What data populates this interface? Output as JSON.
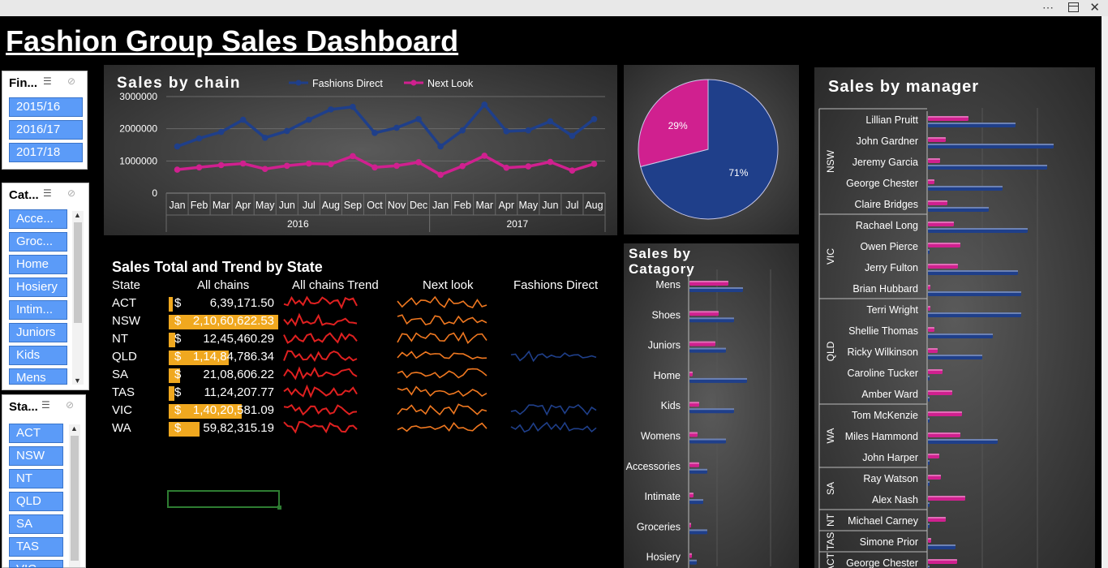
{
  "window": {
    "more_icon": "ellipsis-icon",
    "restore_icon": "restore-icon",
    "close_icon": "close-icon"
  },
  "title": "Fashion Group Sales Dashboard",
  "slicers": {
    "financial_year": {
      "title": "Fin...",
      "items": [
        "2015/16",
        "2016/17",
        "2017/18"
      ]
    },
    "category": {
      "title": "Cat...",
      "items": [
        "Acce...",
        "Groc...",
        "Home",
        "Hosiery",
        "Intim...",
        "Juniors",
        "Kids",
        "Mens"
      ]
    },
    "state": {
      "title": "Sta...",
      "items": [
        "ACT",
        "NSW",
        "NT",
        "QLD",
        "SA",
        "TAS",
        "VIC"
      ]
    }
  },
  "colors": {
    "fashions_direct": "#1f3f8a",
    "next_look": "#d0208f",
    "bar_gold": "#f0a81f",
    "spark_red": "#e02020",
    "spark_orange": "#f07820",
    "spark_blue": "#1f3f8a"
  },
  "table": {
    "title": "Sales Total and Trend by State",
    "headers": {
      "state": "State",
      "all_chains": "All chains",
      "trend": "All chains Trend",
      "next_look": "Next look",
      "fashions_direct": "Fashions Direct"
    },
    "rows": [
      {
        "state": "ACT",
        "dollar": "$",
        "value": "6,39,171.50",
        "share": 0.03
      },
      {
        "state": "NSW",
        "dollar": "$",
        "value": "2,10,60,622.53",
        "share": 1.0
      },
      {
        "state": "NT",
        "dollar": "$",
        "value": "12,45,460.29",
        "share": 0.06
      },
      {
        "state": "QLD",
        "dollar": "$",
        "value": "1,14,84,786.34",
        "share": 0.55
      },
      {
        "state": "SA",
        "dollar": "$",
        "value": "21,08,606.22",
        "share": 0.1
      },
      {
        "state": "TAS",
        "dollar": "$",
        "value": "11,24,207.77",
        "share": 0.05
      },
      {
        "state": "VIC",
        "dollar": "$",
        "value": "1,40,20,581.09",
        "share": 0.67
      },
      {
        "state": "WA",
        "dollar": "$",
        "value": "59,82,315.19",
        "share": 0.28
      }
    ],
    "fashions_direct_rows": [
      false,
      false,
      false,
      true,
      false,
      false,
      true,
      true
    ]
  },
  "chart_data": [
    {
      "type": "line",
      "title": "Sales by chain",
      "categories": [
        "Jan",
        "Feb",
        "Mar",
        "Apr",
        "May",
        "Jun",
        "Jul",
        "Aug",
        "Sep",
        "Oct",
        "Nov",
        "Dec",
        "Jan",
        "Feb",
        "Mar",
        "Apr",
        "May",
        "Jun",
        "Jul",
        "Aug"
      ],
      "year_groups": [
        {
          "label": "2016",
          "count": 12
        },
        {
          "label": "2017",
          "count": 8
        }
      ],
      "ylim": [
        0,
        3000000
      ],
      "yticks": [
        "3000000",
        "2000000",
        "1000000",
        "0"
      ],
      "series": [
        {
          "name": "Fashions Direct",
          "values": [
            1450000,
            1700000,
            1900000,
            2280000,
            1720000,
            1930000,
            2280000,
            2600000,
            2680000,
            1870000,
            2030000,
            2300000,
            1450000,
            1950000,
            2750000,
            1920000,
            1950000,
            2230000,
            1780000,
            2300000
          ]
        },
        {
          "name": "Next Look",
          "values": [
            730000,
            800000,
            870000,
            920000,
            750000,
            850000,
            920000,
            900000,
            1150000,
            800000,
            850000,
            960000,
            570000,
            840000,
            1160000,
            790000,
            830000,
            970000,
            700000,
            910000
          ]
        }
      ],
      "legend": "top"
    },
    {
      "type": "pie",
      "slices": [
        {
          "label": "Fashions Direct",
          "pct": 71,
          "text": "71%"
        },
        {
          "label": "Next Look",
          "pct": 29,
          "text": "29%"
        }
      ]
    },
    {
      "type": "bar",
      "title": "Sales by Catagory",
      "categories": [
        "Mens",
        "Shoes",
        "Juniors",
        "Home",
        "Kids",
        "Womens",
        "Accessories",
        "Intimate",
        "Groceries",
        "Hosiery"
      ],
      "series": [
        {
          "name": "Next Look",
          "values": [
            48,
            36,
            32,
            4,
            12,
            10,
            12,
            5,
            2,
            3
          ]
        },
        {
          "name": "Fashions Direct",
          "values": [
            66,
            55,
            45,
            71,
            55,
            45,
            22,
            17,
            22,
            9
          ]
        }
      ]
    },
    {
      "type": "bar",
      "title": "Sales by manager",
      "groups": [
        {
          "label": "NSW",
          "managers": [
            "Lillian Pruitt",
            "John Gardner",
            "Jeremy Garcia",
            "George Chester",
            "Claire Bridges"
          ]
        },
        {
          "label": "VIC",
          "managers": [
            "Rachael Long",
            "Owen Pierce",
            "Jerry Fulton",
            "Brian Hubbard"
          ]
        },
        {
          "label": "QLD",
          "managers": [
            "Terri Wright",
            "Shellie Thomas",
            "Ricky Wilkinson",
            "Caroline Tucker",
            "Amber Ward"
          ]
        },
        {
          "label": "WA",
          "managers": [
            "Tom McKenzie",
            "Miles Hammond",
            "John Harper"
          ]
        },
        {
          "label": "SA",
          "managers": [
            "Ray Watson",
            "Alex Nash"
          ]
        },
        {
          "label": "NT",
          "managers": [
            "Michael Carney"
          ]
        },
        {
          "label": "TAS",
          "managers": [
            "Simone Prior"
          ]
        },
        {
          "label": "ACT",
          "managers": [
            "George Chester"
          ]
        }
      ],
      "series": [
        {
          "name": "Next Look",
          "values": [
            50,
            22,
            15,
            8,
            24,
            32,
            40,
            37,
            3,
            3,
            8,
            12,
            18,
            30,
            42,
            40,
            14,
            16,
            46,
            22,
            4,
            36,
            4
          ]
        },
        {
          "name": "Fashions Direct",
          "values": [
            108,
            155,
            147,
            92,
            75,
            123,
            2,
            111,
            115,
            115,
            80,
            67,
            2,
            2,
            2,
            86,
            2,
            2,
            2,
            2,
            34,
            2,
            4
          ]
        }
      ]
    }
  ]
}
